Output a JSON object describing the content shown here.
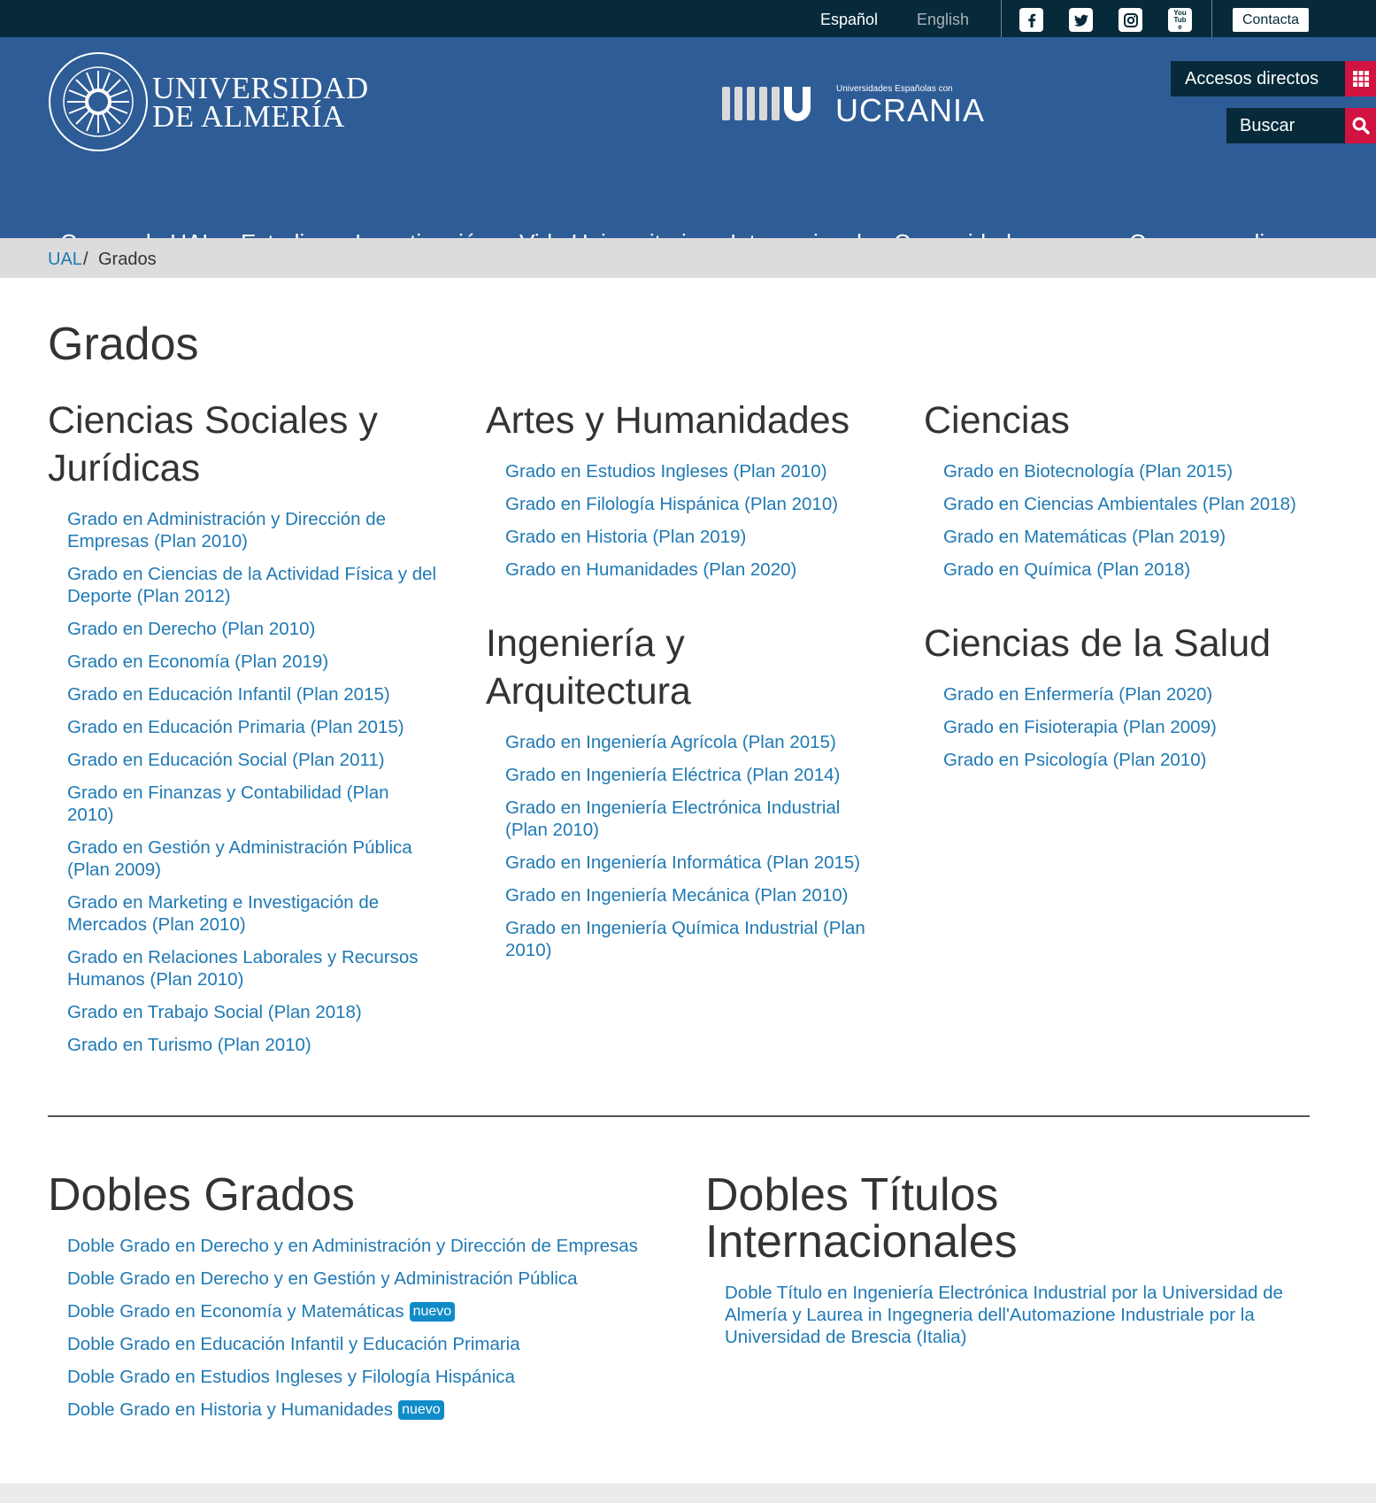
{
  "topbar": {
    "lang_es": "Español",
    "lang_en": "English",
    "social": [
      "facebook-icon",
      "twitter-icon",
      "instagram-icon",
      "youtube-icon"
    ],
    "youtube_text": "You Tube",
    "contact": "Contacta"
  },
  "header": {
    "logo_line1": "UNIVERSIDAD",
    "logo_line2": "DE ALMERÍA",
    "seal_text": "IN LUMINE SAPIENTIA · UNIVERSITAS ALMERIENSIS",
    "ucrania_small": "Universidades Españolas con",
    "ucrania_big": "UCRANIA",
    "accesos": "Accesos directos",
    "buscar": "Buscar"
  },
  "nav": [
    "Conoce la UAL",
    "Estudios",
    "Investigación",
    "Vida Universitaria",
    "Internacional",
    "Comunidad",
    "Campus on-line"
  ],
  "breadcrumb": {
    "home": "UAL",
    "sep": "/",
    "current": "Grados"
  },
  "page_title": "Grados",
  "sections": {
    "sociales": {
      "title": "Ciencias Sociales y Jurídicas",
      "items": [
        "Grado en Administración y Dirección de Empresas (Plan 2010)",
        "Grado en Ciencias de la Actividad Física y del Deporte (Plan 2012)",
        "Grado en Derecho (Plan 2010)",
        "Grado en Economía (Plan 2019)",
        "Grado en Educación Infantil (Plan 2015)",
        "Grado en Educación Primaria (Plan 2015)",
        "Grado en Educación Social (Plan 2011)",
        "Grado en Finanzas y Contabilidad (Plan 2010)",
        "Grado en Gestión y Administración Pública (Plan 2009)",
        "Grado en Marketing e Investigación de Mercados (Plan 2010)",
        "Grado en Relaciones Laborales y Recursos Humanos (Plan 2010)",
        "Grado en Trabajo Social (Plan 2018)",
        "Grado en Turismo (Plan 2010)"
      ]
    },
    "artes": {
      "title": "Artes y Humanidades",
      "items": [
        "Grado en Estudios Ingleses (Plan 2010)",
        "Grado en Filología Hispánica (Plan 2010)",
        "Grado en Historia (Plan 2019)",
        "Grado en Humanidades (Plan 2020)"
      ]
    },
    "ingenieria": {
      "title": "Ingeniería y Arquitectura",
      "items": [
        "Grado en Ingeniería Agrícola (Plan 2015)",
        "Grado en Ingeniería Eléctrica (Plan 2014)",
        "Grado en Ingeniería Electrónica Industrial (Plan 2010)",
        "Grado en Ingeniería Informática (Plan 2015)",
        "Grado en Ingeniería Mecánica (Plan 2010)",
        "Grado en Ingeniería Química Industrial (Plan 2010)"
      ]
    },
    "ciencias": {
      "title": "Ciencias",
      "items": [
        "Grado en Biotecnología (Plan 2015)",
        "Grado en Ciencias Ambientales (Plan 2018)",
        "Grado en Matemáticas (Plan 2019)",
        "Grado en Química (Plan 2018)"
      ]
    },
    "salud": {
      "title": "Ciencias de la Salud",
      "items": [
        "Grado en Enfermería (Plan 2020)",
        "Grado en Fisioterapia (Plan 2009)",
        "Grado en Psicología (Plan 2010)"
      ]
    }
  },
  "dobles": {
    "title": "Dobles Grados",
    "items": [
      "Doble Grado en Derecho y en Administración y Dirección de Empresas",
      "Doble Grado en Derecho y en Gestión y Administración Pública",
      "Doble Grado en Economía y Matemáticas",
      "Doble Grado en Educación Infantil y Educación Primaria",
      "Doble Grado en Estudios Ingleses y Filología Hispánica",
      "Doble Grado en Historia y Humanidades"
    ],
    "badge": "nuevo"
  },
  "internacionales": {
    "title": "Dobles Títulos Internacionales",
    "items": [
      "Doble Título en Ingeniería Electrónica Industrial por la Universidad de Almería y Laurea in Ingegneria dell'Automazione Industriale por la Universidad de Brescia (Italia)"
    ]
  },
  "colors": {
    "topbar": "#062a3a",
    "header": "#2e5c96",
    "accent": "#d11341",
    "link": "#1f79b4",
    "badge": "#0f8cc8"
  }
}
